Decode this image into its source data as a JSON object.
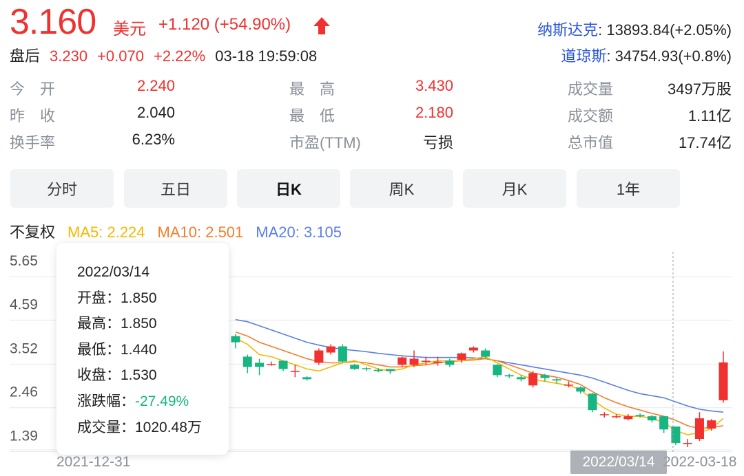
{
  "quote": {
    "price": "3.160",
    "currency": "美元",
    "change": "+1.120 (+54.90%)",
    "after_label": "盘后",
    "after_price": "3.230",
    "after_change": "+0.070",
    "after_pct": "+2.22%",
    "after_time": "03-18 19:59:08"
  },
  "indices": [
    {
      "name": "纳斯达克",
      "value": ": 13893.84(+2.05%)"
    },
    {
      "name": "道琼斯",
      "value": ": 34754.93(+0.8%)"
    }
  ],
  "stats": [
    {
      "label": "今　开",
      "value": "2.240",
      "color": "#f0312f"
    },
    {
      "label": "昨　收",
      "value": "2.040",
      "color": "#222222"
    },
    {
      "label": "换手率",
      "value": "6.23%",
      "color": "#222222"
    },
    {
      "label": "最　高",
      "value": "3.430",
      "color": "#f0312f"
    },
    {
      "label": "最　低",
      "value": "2.180",
      "color": "#f0312f"
    },
    {
      "label": "市盈(TTM)",
      "value": "亏损",
      "color": "#222222"
    },
    {
      "label": "成交量",
      "value": "3497万股",
      "color": "#222222"
    },
    {
      "label": "成交额",
      "value": "1.11亿",
      "color": "#222222"
    },
    {
      "label": "总市值",
      "value": "17.74亿",
      "color": "#222222"
    }
  ],
  "tabs": [
    "分时",
    "五日",
    "日K",
    "周K",
    "月K",
    "1年"
  ],
  "active_tab": "日K",
  "ma": {
    "adjust": "不复权",
    "ma5": "MA5: 2.224",
    "ma10": "MA10: 2.501",
    "ma20": "MA20: 3.105"
  },
  "colors": {
    "up": "#f0312f",
    "down": "#17b581",
    "ma5": "#f5b800",
    "ma10": "#f57d2a",
    "ma20": "#5b7ee8"
  },
  "tooltip": {
    "date": "2022/03/14",
    "open": "开盘：1.850",
    "high": "最高：1.850",
    "low": "最低：1.440",
    "close": "收盘：1.530",
    "chg_label": "涨跌幅：",
    "chg_value": "-27.49%",
    "volume": "成交量：1020.48万"
  },
  "axis": {
    "date_start": "2021-12-31",
    "date_end": "2022-03-18",
    "hover_date": "2022/03/14"
  },
  "chart_data": {
    "type": "candlestick",
    "y_ticks": [
      "5.65",
      "4.59",
      "3.52",
      "2.46",
      "1.39"
    ],
    "ylim": [
      1.1,
      5.65
    ],
    "candles": [
      [
        3.8,
        3.65,
        3.85,
        3.5
      ],
      [
        3.3,
        3.05,
        3.35,
        2.9
      ],
      [
        3.15,
        3.05,
        3.25,
        2.85
      ],
      [
        3.12,
        3.12,
        3.18,
        3.08
      ],
      [
        3.2,
        3.0,
        3.2,
        2.95
      ],
      [
        2.95,
        2.95,
        3.1,
        2.8
      ],
      [
        2.8,
        2.75,
        2.82,
        2.72
      ],
      [
        3.15,
        3.45,
        3.5,
        3.1
      ],
      [
        3.4,
        3.55,
        3.6,
        3.35
      ],
      [
        3.55,
        3.18,
        3.6,
        3.15
      ],
      [
        3.1,
        3.0,
        3.12,
        2.98
      ],
      [
        3.02,
        3.0,
        3.05,
        2.95
      ],
      [
        2.98,
        2.95,
        3.02,
        2.92
      ],
      [
        3.0,
        2.95,
        3.0,
        2.88
      ],
      [
        3.1,
        3.28,
        3.3,
        3.05
      ],
      [
        3.1,
        3.25,
        3.45,
        3.05
      ],
      [
        3.2,
        3.2,
        3.3,
        3.1
      ],
      [
        3.15,
        3.18,
        3.3,
        3.08
      ],
      [
        3.2,
        3.1,
        3.25,
        3.05
      ],
      [
        3.22,
        3.38,
        3.4,
        3.15
      ],
      [
        3.45,
        3.52,
        3.55,
        3.4
      ],
      [
        3.45,
        3.3,
        3.5,
        3.25
      ],
      [
        3.1,
        2.85,
        3.12,
        2.8
      ],
      [
        2.85,
        2.82,
        2.88,
        2.78
      ],
      [
        2.8,
        2.75,
        2.85,
        2.7
      ],
      [
        2.6,
        2.9,
        2.95,
        2.55
      ],
      [
        2.85,
        2.78,
        2.88,
        2.7
      ],
      [
        2.75,
        2.72,
        2.78,
        2.65
      ],
      [
        2.62,
        2.62,
        2.7,
        2.55
      ],
      [
        2.55,
        2.45,
        2.58,
        2.4
      ],
      [
        2.4,
        2.0,
        2.42,
        1.95
      ],
      [
        1.9,
        1.9,
        1.95,
        1.82
      ],
      [
        1.85,
        1.85,
        1.9,
        1.8
      ],
      [
        1.78,
        1.85,
        1.9,
        1.75
      ],
      [
        1.88,
        1.85,
        1.92,
        1.82
      ],
      [
        1.85,
        1.75,
        1.88,
        1.7
      ],
      [
        1.85,
        1.53,
        1.85,
        1.44
      ],
      [
        1.6,
        1.2,
        1.6,
        1.15
      ],
      [
        1.2,
        1.2,
        1.3,
        1.1
      ],
      [
        1.3,
        1.8,
        1.95,
        1.25
      ],
      [
        1.55,
        1.75,
        1.78,
        1.5
      ],
      [
        2.24,
        3.16,
        3.43,
        2.18
      ]
    ],
    "ma5": [
      3.75,
      3.6,
      3.35,
      3.3,
      3.2,
      3.1,
      3.0,
      2.95,
      3.05,
      3.15,
      3.2,
      3.1,
      3.0,
      2.95,
      3.0,
      3.1,
      3.15,
      3.2,
      3.2,
      3.2,
      3.25,
      3.3,
      3.15,
      3.0,
      2.85,
      2.75,
      2.7,
      2.65,
      2.6,
      2.5,
      2.25,
      2.05,
      1.9,
      1.85,
      1.85,
      1.8,
      1.7,
      1.5,
      1.4,
      1.45,
      1.55,
      1.8
    ],
    "ma10": [
      3.9,
      3.8,
      3.65,
      3.55,
      3.45,
      3.35,
      3.25,
      3.18,
      3.15,
      3.15,
      3.18,
      3.15,
      3.1,
      3.05,
      3.05,
      3.08,
      3.1,
      3.15,
      3.18,
      3.2,
      3.22,
      3.25,
      3.2,
      3.1,
      3.0,
      2.9,
      2.85,
      2.8,
      2.72,
      2.62,
      2.45,
      2.3,
      2.18,
      2.08,
      2.0,
      1.92,
      1.85,
      1.75,
      1.62,
      1.55,
      1.58,
      1.62
    ],
    "ma20": [
      4.2,
      4.15,
      4.05,
      3.95,
      3.85,
      3.75,
      3.65,
      3.58,
      3.52,
      3.48,
      3.45,
      3.42,
      3.38,
      3.35,
      3.32,
      3.3,
      3.28,
      3.28,
      3.28,
      3.28,
      3.27,
      3.25,
      3.2,
      3.15,
      3.1,
      3.05,
      3.0,
      2.95,
      2.9,
      2.85,
      2.78,
      2.68,
      2.58,
      2.48,
      2.4,
      2.35,
      2.3,
      2.2,
      2.1,
      2.02,
      1.98,
      1.95
    ]
  }
}
